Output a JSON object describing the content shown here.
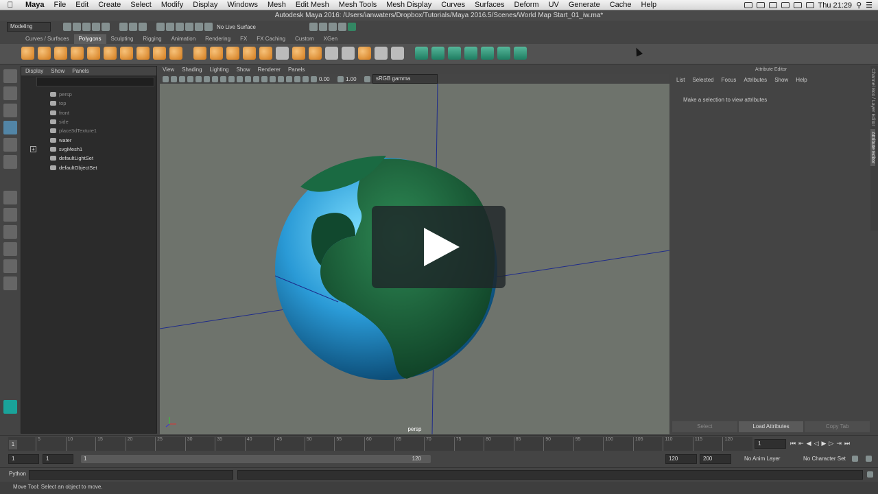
{
  "mac_menu": {
    "app": "Maya",
    "items": [
      "File",
      "Edit",
      "Create",
      "Select",
      "Modify",
      "Display",
      "Windows",
      "Mesh",
      "Edit Mesh",
      "Mesh Tools",
      "Mesh Display",
      "Curves",
      "Surfaces",
      "Deform",
      "UV",
      "Generate",
      "Cache",
      "Help"
    ],
    "clock": "Thu 21:29"
  },
  "window_title": "Autodesk Maya 2016: /Users/ianwaters/Dropbox/Tutorials/Maya 2016.5/Scenes/World Map Start_01_iw.ma*",
  "status_line": {
    "menuset": "Modeling",
    "live_surface": "No Live Surface"
  },
  "shelf_tabs": [
    {
      "label": "Curves / Surfaces",
      "active": false
    },
    {
      "label": "Polygons",
      "active": true
    },
    {
      "label": "Sculpting",
      "active": false
    },
    {
      "label": "Rigging",
      "active": false
    },
    {
      "label": "Animation",
      "active": false
    },
    {
      "label": "Rendering",
      "active": false
    },
    {
      "label": "FX",
      "active": false
    },
    {
      "label": "FX Caching",
      "active": false
    },
    {
      "label": "Custom",
      "active": false
    },
    {
      "label": "XGen",
      "active": false
    }
  ],
  "outliner": {
    "menu": [
      "Display",
      "Show",
      "Panels"
    ],
    "items": [
      {
        "label": "persp",
        "dim": true,
        "icon": "camera-icon"
      },
      {
        "label": "top",
        "dim": true,
        "icon": "camera-icon"
      },
      {
        "label": "front",
        "dim": true,
        "icon": "camera-icon"
      },
      {
        "label": "side",
        "dim": true,
        "icon": "camera-icon"
      },
      {
        "label": "place3dTexture1",
        "dim": true,
        "icon": "texture-icon"
      },
      {
        "label": "water",
        "dim": false,
        "icon": "transform-icon"
      },
      {
        "label": "svgMesh1",
        "dim": false,
        "icon": "transform-icon",
        "expandable": true
      },
      {
        "label": "defaultLightSet",
        "dim": false,
        "icon": "set-icon"
      },
      {
        "label": "defaultObjectSet",
        "dim": false,
        "icon": "set-icon"
      }
    ]
  },
  "viewport": {
    "menu": [
      "View",
      "Shading",
      "Lighting",
      "Show",
      "Renderer",
      "Panels"
    ],
    "exposure": "0.00",
    "gamma": "1.00",
    "color_space": "sRGB gamma",
    "camera": "persp"
  },
  "attribute_editor": {
    "title": "Attribute Editor",
    "menu": [
      "List",
      "Selected",
      "Focus",
      "Attributes",
      "Show",
      "Help"
    ],
    "message": "Make a selection to view attributes",
    "buttons": [
      "Select",
      "Load Attributes",
      "Copy Tab"
    ]
  },
  "side_tabs": [
    "Channel Box / Layer Editor",
    "Attribute Editor"
  ],
  "timeline": {
    "ticks": [
      "5",
      "10",
      "15",
      "20",
      "25",
      "30",
      "35",
      "40",
      "45",
      "50",
      "55",
      "60",
      "65",
      "70",
      "75",
      "80",
      "85",
      "90",
      "95",
      "100",
      "105",
      "110",
      "115",
      "120"
    ],
    "current_frame": "1",
    "frame_field": "1"
  },
  "range": {
    "start": "1",
    "playback_start": "1",
    "slider_start": "1",
    "slider_end": "120",
    "playback_end": "120",
    "end": "200",
    "anim_layer": "No Anim Layer",
    "char_set": "No Character Set"
  },
  "command_line": {
    "label": "Python"
  },
  "help_line": "Move Tool: Select an object to move."
}
